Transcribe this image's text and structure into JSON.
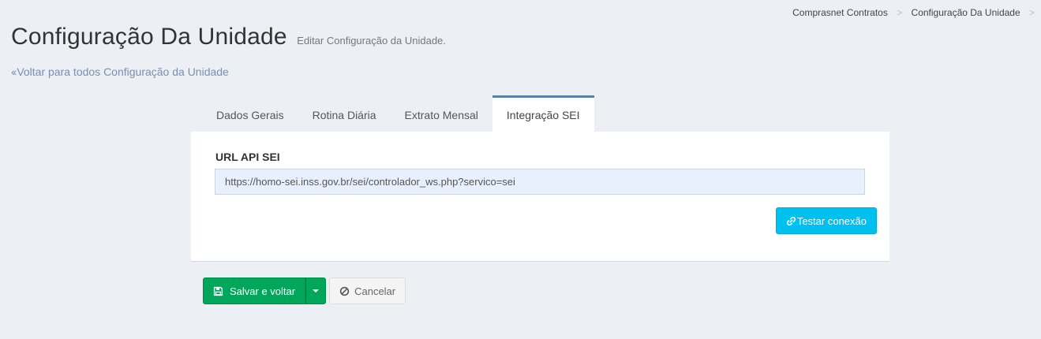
{
  "breadcrumb": {
    "items": [
      "Comprasnet Contratos",
      "Configuração Da Unidade"
    ],
    "separator": ">"
  },
  "header": {
    "title": "Configuração Da Unidade",
    "subtitle": "Editar Configuração da Unidade."
  },
  "back_link": {
    "label": "Voltar para todos Configuração da Unidade",
    "icon": "double-chevron-left-icon"
  },
  "tabs": [
    {
      "label": "Dados Gerais",
      "active": false
    },
    {
      "label": "Rotina Diária",
      "active": false
    },
    {
      "label": "Extrato Mensal",
      "active": false
    },
    {
      "label": "Integração SEI",
      "active": true
    }
  ],
  "form": {
    "url_label": "URL API SEI",
    "url_value": "https://homo-sei.inss.gov.br/sei/controlador_ws.php?servico=sei",
    "test_button_label": "Testar conexão",
    "test_button_icon": "link-icon"
  },
  "actions": {
    "save_label": "Salvar e voltar",
    "save_icon": "floppy-disk-icon",
    "cancel_label": "Cancelar",
    "cancel_icon": "ban-icon"
  },
  "colors": {
    "primary": "#3c8dbc",
    "success": "#00a65a",
    "info": "#00c0ef",
    "background": "#ecf0f5"
  }
}
